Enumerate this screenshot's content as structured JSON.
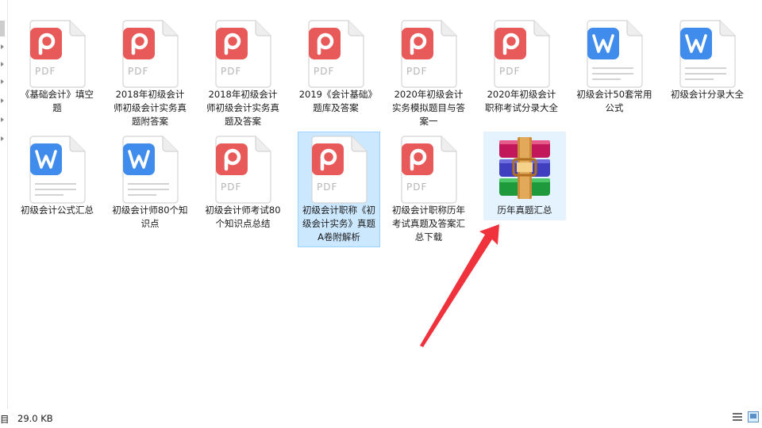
{
  "files": [
    {
      "name": "《基础会计》填空题",
      "type": "pdf",
      "icon": "pdf-file-icon"
    },
    {
      "name": "2018年初级会计师初级会计实务真题附答案",
      "type": "pdf",
      "icon": "pdf-file-icon"
    },
    {
      "name": "2018年初级会计师初级会计实务真题及答案",
      "type": "pdf",
      "icon": "pdf-file-icon"
    },
    {
      "name": "2019《会计基础》题库及答案",
      "type": "pdf",
      "icon": "pdf-file-icon"
    },
    {
      "name": "2020年初级会计实务模拟题目与答案一",
      "type": "pdf",
      "icon": "pdf-file-icon"
    },
    {
      "name": "2020年初级会计职称考试分录大全",
      "type": "pdf",
      "icon": "pdf-file-icon"
    },
    {
      "name": "初级会计50套常用公式",
      "type": "word",
      "icon": "word-file-icon"
    },
    {
      "name": "初级会计分录大全",
      "type": "word",
      "icon": "word-file-icon"
    },
    {
      "name": "初级会计公式汇总",
      "type": "word",
      "icon": "word-file-icon"
    },
    {
      "name": "初级会计师80个知识点",
      "type": "word",
      "icon": "word-file-icon"
    },
    {
      "name": "初级会计师考试80个知识点总结",
      "type": "pdf",
      "icon": "pdf-file-icon"
    },
    {
      "name": "初级会计职称《初级会计实务》真题A卷附解析",
      "type": "pdf",
      "icon": "pdf-file-icon",
      "state": "selected"
    },
    {
      "name": "初级会计职称历年考试真题及答案汇总下载",
      "type": "pdf",
      "icon": "pdf-file-icon"
    },
    {
      "name": "历年真题汇总",
      "type": "archive",
      "icon": "winrar-archive-icon",
      "state": "hover"
    }
  ],
  "pdf_badge_text": "PDF",
  "status": {
    "left_text": "目",
    "size_text": "29.0 KB"
  },
  "colors": {
    "selected_bg": "#cce8ff",
    "pdf_red": "#e85a5a",
    "word_blue": "#3f8cec",
    "annotation_arrow": "#f0323c"
  }
}
